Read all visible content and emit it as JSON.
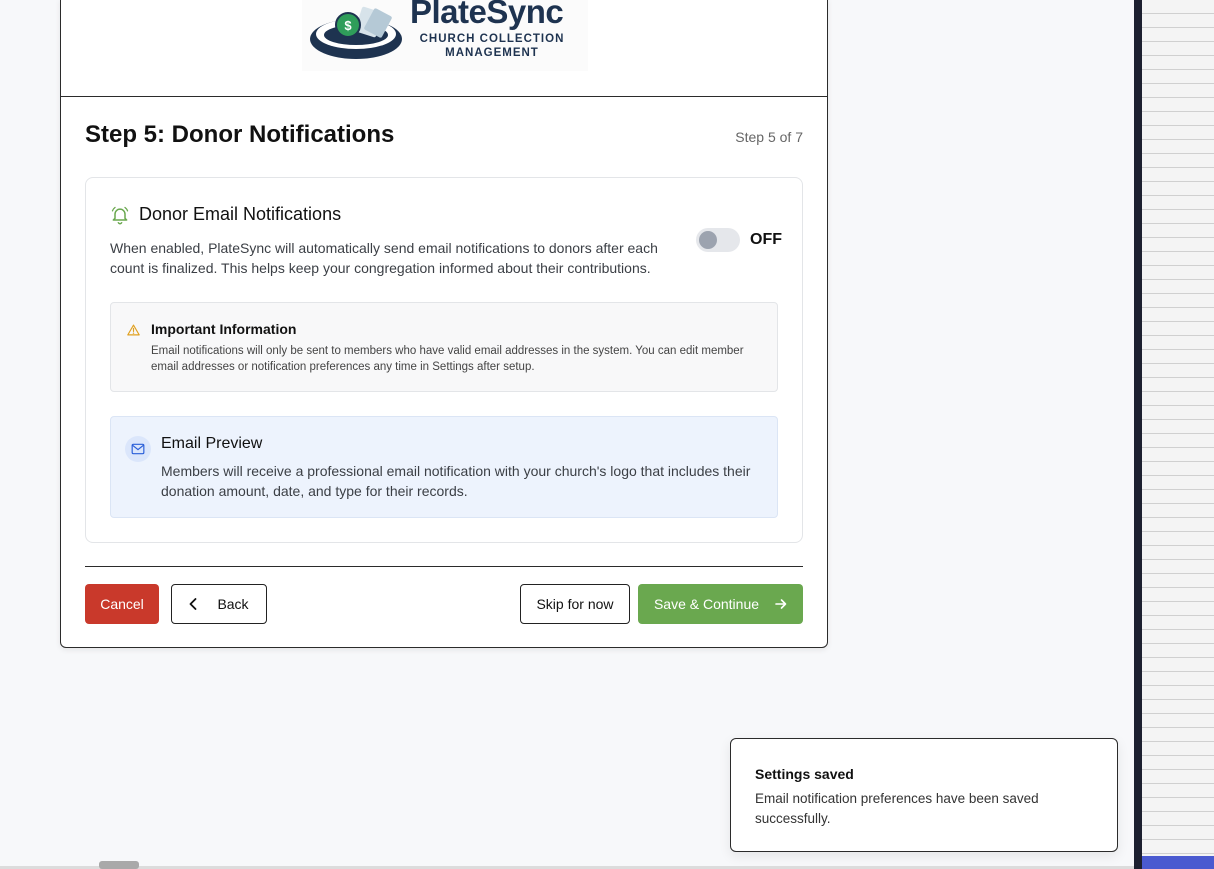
{
  "logo": {
    "name": "PlateSync",
    "tagline": "CHURCH COLLECTION MANAGEMENT",
    "coin_symbol": "$"
  },
  "step": {
    "title": "Step 5: Donor Notifications",
    "counter": "Step 5 of 7"
  },
  "notifications": {
    "title": "Donor Email Notifications",
    "icon": "bell-icon",
    "description": "When enabled, PlateSync will automatically send email notifications to donors after each count is finalized. This helps keep your congregation informed about their contributions.",
    "toggle_state": "OFF",
    "enabled": false
  },
  "info": {
    "icon": "warning-icon",
    "title": "Important Information",
    "text": "Email notifications will only be sent to members who have valid email addresses in the system. You can edit member email addresses or notification preferences any time in Settings after setup."
  },
  "preview": {
    "icon": "mail-icon",
    "title": "Email Preview",
    "text": "Members will receive a professional email notification with your church's logo that includes their donation amount, date, and type for their records."
  },
  "buttons": {
    "cancel": "Cancel",
    "back": "Back",
    "skip": "Skip for now",
    "save": "Save & Continue"
  },
  "toast": {
    "title": "Settings saved",
    "text": "Email notification preferences have been saved successfully."
  },
  "colors": {
    "cancel": "#c9392b",
    "save": "#6aa84f",
    "bell": "#6aa84f",
    "warning": "#e0a020",
    "mail": "#2b5fd9",
    "brand": "#1e3350"
  }
}
